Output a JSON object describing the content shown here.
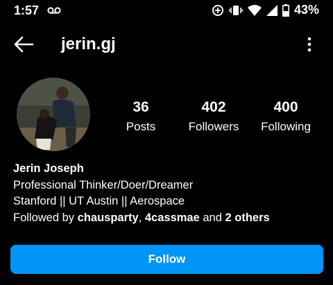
{
  "status_bar": {
    "time": "1:57",
    "battery_percent": "43%",
    "icons": [
      "voicemail-icon",
      "data-saver-icon",
      "vibrate-icon",
      "wifi-icon",
      "signal-icon",
      "battery-icon"
    ]
  },
  "header": {
    "username": "jerin.gj",
    "back_icon": "arrow-left-icon",
    "more_icon": "more-vertical-icon"
  },
  "profile": {
    "avatar": "profile-photo",
    "stats": {
      "posts": {
        "value": "36",
        "label": "Posts"
      },
      "followers": {
        "value": "402",
        "label": "Followers"
      },
      "following": {
        "value": "400",
        "label": "Following"
      }
    },
    "bio": {
      "name": "Jerin Joseph",
      "line1": "Professional Thinker/Doer/Dreamer",
      "line2": "Stanford || UT Austin || Aerospace",
      "followed_by_prefix": "Followed by ",
      "followed_by_user1": "chausparty",
      "separator": ", ",
      "followed_by_user2": "4cassmae",
      "and_text": " and ",
      "others_text": "2 others"
    }
  },
  "actions": {
    "follow_label": "Follow"
  },
  "colors": {
    "background": "#000000",
    "text": "#ffffff",
    "follow_button": "#0095f6"
  }
}
